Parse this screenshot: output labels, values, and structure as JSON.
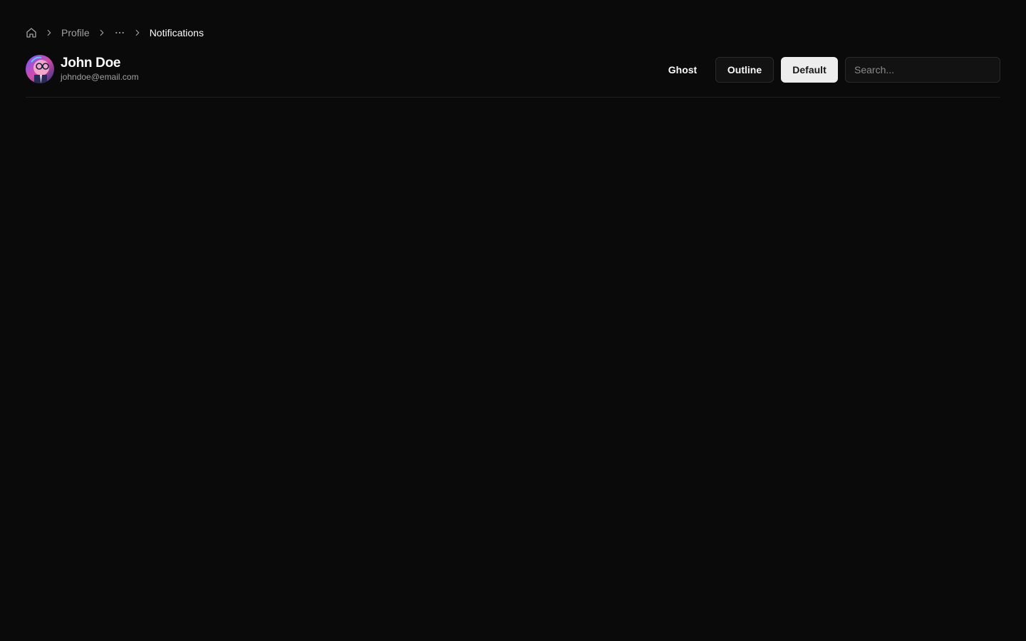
{
  "breadcrumb": {
    "home_icon": "home-icon",
    "items": [
      "Profile",
      "Notifications"
    ],
    "ellipsis_icon": "more-horizontal-icon",
    "separator_icon": "chevron-right-icon"
  },
  "user": {
    "name": "John Doe",
    "email": "johndoe@email.com"
  },
  "actions": {
    "ghost_label": "Ghost",
    "outline_label": "Outline",
    "default_label": "Default"
  },
  "search": {
    "placeholder": "Search...",
    "value": ""
  },
  "colors": {
    "background": "#0a0a0a",
    "foreground": "#fafafa",
    "muted": "#a1a1a1",
    "border": "#2a2a2a",
    "primary_button": "#ededed"
  }
}
